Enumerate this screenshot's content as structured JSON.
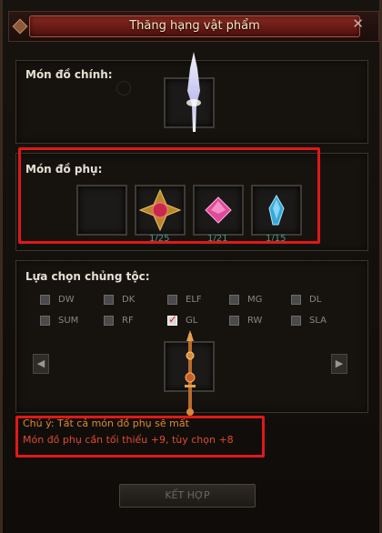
{
  "window": {
    "title": "Thăng hạng vật phẩm",
    "close_symbol": "✕"
  },
  "main_item": {
    "label": "Món đồ chính:",
    "item_icon": "sword-icon"
  },
  "sub_items": {
    "label": "Món đồ phụ:",
    "slots": [
      {
        "icon": "empty-slot",
        "count": ""
      },
      {
        "icon": "jewel-of-soul-icon",
        "count": "1/25"
      },
      {
        "icon": "pink-gem-icon",
        "count": "1/21"
      },
      {
        "icon": "blue-crystal-icon",
        "count": "1/15"
      }
    ]
  },
  "race": {
    "label": "Lựa chọn chủng tộc:",
    "row1": [
      {
        "name": "DW",
        "checked": false
      },
      {
        "name": "DK",
        "checked": false
      },
      {
        "name": "ELF",
        "checked": false
      },
      {
        "name": "MG",
        "checked": false
      },
      {
        "name": "DL",
        "checked": false
      }
    ],
    "row2": [
      {
        "name": "SUM",
        "checked": false
      },
      {
        "name": "RF",
        "checked": false
      },
      {
        "name": "GL",
        "checked": true
      },
      {
        "name": "RW",
        "checked": false
      },
      {
        "name": "SLA",
        "checked": false
      }
    ],
    "result_icon": "lance-icon",
    "prev_arrow": "◀",
    "next_arrow": "▶"
  },
  "notes": {
    "line1": "Chú ý: Tất cả món đồ phụ sẽ mất",
    "line2": "Món đồ phụ cần tối thiểu +9, tùy chọn +8"
  },
  "combine_button": "KẾT HỢP",
  "colors": {
    "highlight_border": "#e01818",
    "note_warning": "#e08a2c",
    "note_requirement": "#e04a2c",
    "count_text": "#3f9a8c"
  }
}
